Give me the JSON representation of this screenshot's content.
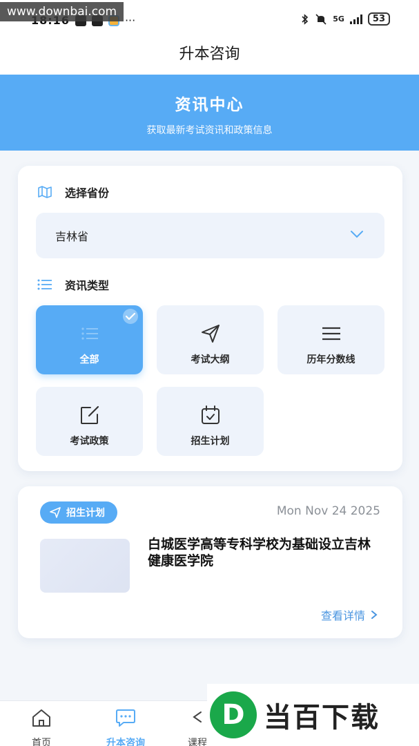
{
  "watermark": {
    "top_text": "www.downbai.com",
    "logo_text": "当百下载",
    "logo_letter": "D"
  },
  "status_bar": {
    "time": "18:16",
    "network": "5G",
    "battery": "53"
  },
  "nav": {
    "title": "升本咨询"
  },
  "banner": {
    "title": "资讯中心",
    "subtitle": "获取最新考试资讯和政策信息"
  },
  "filter": {
    "province_label": "选择省份",
    "province_value": "吉林省",
    "type_label": "资讯类型",
    "types": [
      {
        "label": "全部",
        "icon": "list-icon",
        "selected": true
      },
      {
        "label": "考试大纲",
        "icon": "send-icon",
        "selected": false
      },
      {
        "label": "历年分数线",
        "icon": "menu-icon",
        "selected": false
      },
      {
        "label": "考试政策",
        "icon": "edit-icon",
        "selected": false
      },
      {
        "label": "招生计划",
        "icon": "calendar-check-icon",
        "selected": false
      }
    ]
  },
  "news": {
    "tag": "招生计划",
    "date": "Mon Nov 24 2025",
    "title": "白城医学高等专科学校为基础设立吉林健康医学院",
    "more_label": "查看详情"
  },
  "tabs": [
    {
      "label": "首页",
      "icon": "home-icon",
      "active": false
    },
    {
      "label": "升本咨询",
      "icon": "chat-icon",
      "active": true
    },
    {
      "label": "课程",
      "icon": "share-icon",
      "active": false
    }
  ],
  "colors": {
    "accent": "#57abf5",
    "tile_bg": "#eef3fb",
    "link": "#4a95e0"
  }
}
